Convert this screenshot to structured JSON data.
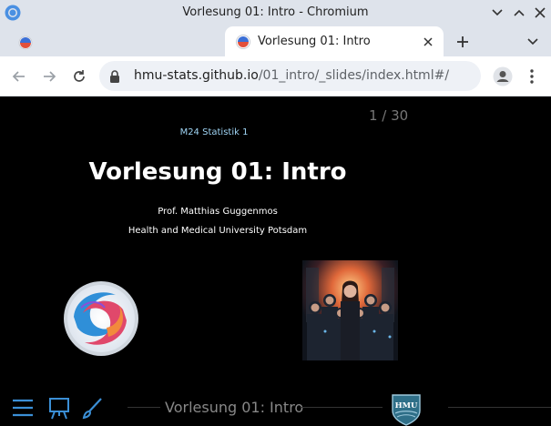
{
  "window": {
    "title": "Vorlesung 01: Intro - Chromium"
  },
  "tabs": {
    "active_title": "Vorlesung 01: Intro"
  },
  "toolbar": {
    "url_host": "hmu-stats.github.io",
    "url_path": "/01_intro/_slides/index.html#/"
  },
  "slide": {
    "counter": "1 / 30",
    "subtitle": "M24 Statistik 1",
    "title": "Vorlesung 01: Intro",
    "author": "Prof. Matthias Guggenmos",
    "affiliation": "Health and Medical University Potsdam",
    "footer_title": "Vorlesung 01: Intro",
    "badge_text": "HMU"
  },
  "colors": {
    "accent_blue": "#3b8fd6",
    "subtitle_blue": "#9fd4f4",
    "chrome_frame": "#dee3eb"
  },
  "icons": {
    "footer": [
      "menu-icon",
      "whiteboard-icon",
      "brush-icon"
    ]
  }
}
